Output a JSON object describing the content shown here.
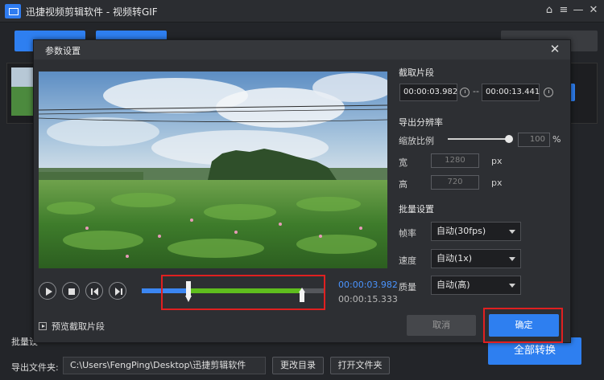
{
  "app": {
    "title": "迅捷视频剪辑软件 - 视频转GIF",
    "logo_icon": "scissors-film-icon"
  },
  "window_controls": {
    "home_icon": "⌂",
    "menu_icon": "≡",
    "minimize_icon": "—",
    "close_icon": "✕"
  },
  "bottom": {
    "batch_label": "批量设",
    "output_label": "导出文件夹:",
    "output_path": "C:\\Users\\FengPing\\Desktop\\迅捷剪辑软件",
    "change_dir": "更改目录",
    "open_folder": "打开文件夹",
    "convert_all": "全部转换"
  },
  "dialog": {
    "title": "参数设置",
    "close_icon": "✕",
    "preview_clip_label": "预览截取片段",
    "current_time": "00:00:03.982",
    "total_time": "00:00:15.333",
    "clip": {
      "section_title": "截取片段",
      "start": "00:00:03.982",
      "separator": "--",
      "end": "00:00:13.441"
    },
    "resolution": {
      "section_title": "导出分辨率",
      "scale_label": "缩放比例",
      "scale_value": "100",
      "scale_unit": "%",
      "scale_fraction": 1.0,
      "width_label": "宽",
      "width_value": "1280",
      "width_unit": "px",
      "height_label": "高",
      "height_value": "720",
      "height_unit": "px"
    },
    "batch": {
      "section_title": "批量设置",
      "fps_label": "帧率",
      "fps_value": "自动(30fps)",
      "speed_label": "速度",
      "speed_value": "自动(1x)",
      "quality_label": "质量",
      "quality_value": "自动(高)"
    },
    "cancel": "取消",
    "confirm": "确定"
  },
  "colors": {
    "accent": "#2e7ff0",
    "clip_range": "#5fbe1e",
    "highlight_box": "#e02020"
  }
}
